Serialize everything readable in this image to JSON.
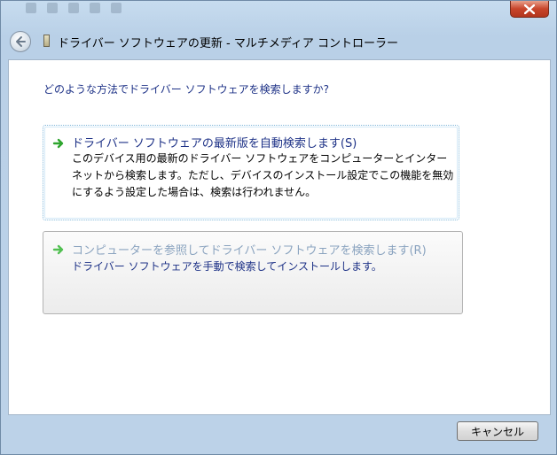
{
  "window": {
    "title": "ドライバー ソフトウェアの更新 - マルチメディア コントローラー"
  },
  "content": {
    "question": "どのような方法でドライバー ソフトウェアを検索しますか?",
    "options": [
      {
        "title": "ドライバー ソフトウェアの最新版を自動検索します(S)",
        "description": "このデバイス用の最新のドライバー ソフトウェアをコンピューターとインターネットから検索します。ただし、デバイスのインストール設定でこの機能を無効にするよう設定した場合は、検索は行われません。",
        "icon": "green-arrow-icon"
      },
      {
        "title": "コンピューターを参照してドライバー ソフトウェアを検索します(R)",
        "description": "ドライバー ソフトウェアを手動で検索してインストールします。",
        "icon": "green-arrow-icon"
      }
    ]
  },
  "footer": {
    "cancel_label": "キャンセル"
  },
  "colors": {
    "link_blue": "#1e3287",
    "disabled_title": "#8aa3bf",
    "close_red": "#c8452b",
    "arrow_green": "#2fa52f"
  }
}
